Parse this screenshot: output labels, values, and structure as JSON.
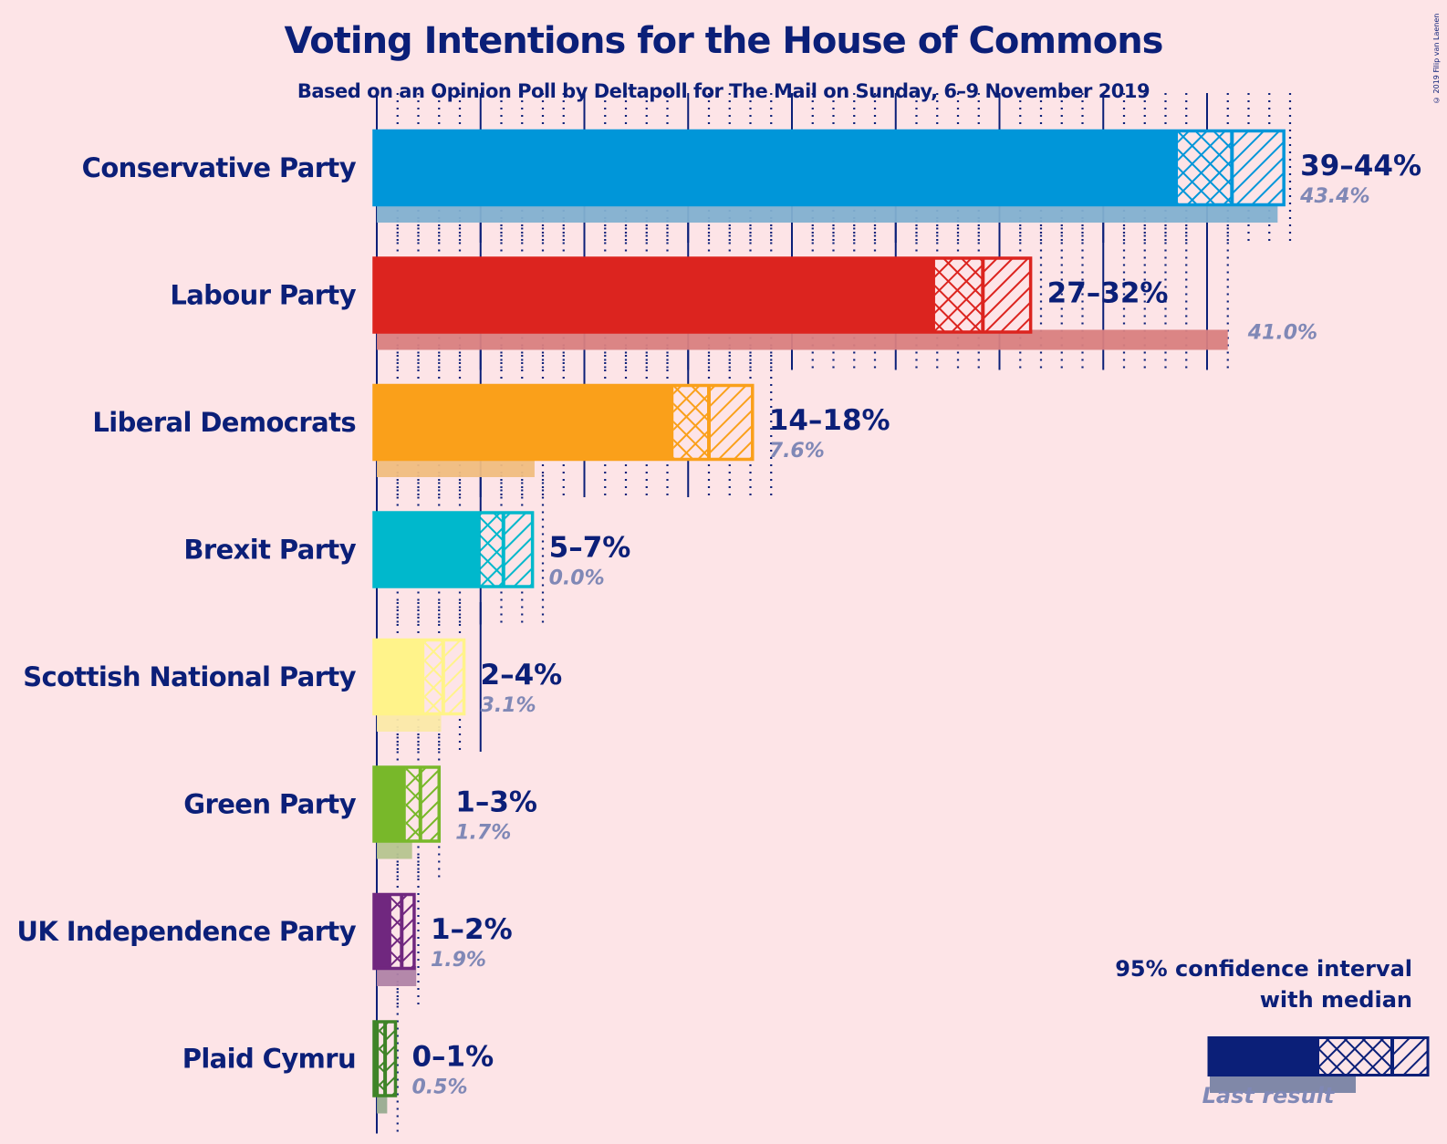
{
  "title": "Voting Intentions for the House of Commons",
  "subtitle": "Based on an Opinion Poll by Deltapoll for The Mail on Sunday, 6–9 November 2019",
  "copyright": "© 2019 Filip van Laenen",
  "legend": {
    "title_line1": "95% confidence interval",
    "title_line2": "with median",
    "last_result": "Last result",
    "color": "#0b1f78"
  },
  "chart_data": {
    "type": "bar",
    "title": "Voting Intentions for the House of Commons",
    "subtitle": "Based on an Opinion Poll by Deltapoll for The Mail on Sunday, 6–9 November 2019",
    "xlabel": "",
    "ylabel": "",
    "unit": "%",
    "xlim": [
      0,
      45
    ],
    "grid": {
      "major_every": 5,
      "minor_every": 1
    },
    "legend_position": "bottom-right",
    "categories": [
      "Conservative Party",
      "Labour Party",
      "Liberal Democrats",
      "Brexit Party",
      "Scottish National Party",
      "Green Party",
      "UK Independence Party",
      "Plaid Cymru"
    ],
    "series": [
      {
        "name": "95% confidence interval low",
        "values": [
          38.6,
          26.9,
          14.3,
          5.0,
          2.3,
          1.4,
          0.7,
          0.1
        ]
      },
      {
        "name": "Median",
        "values": [
          41.2,
          29.2,
          16.0,
          6.1,
          3.2,
          2.1,
          1.2,
          0.4
        ]
      },
      {
        "name": "95% confidence interval high",
        "values": [
          43.7,
          31.5,
          18.1,
          7.5,
          4.2,
          3.0,
          1.8,
          0.9
        ]
      },
      {
        "name": "Last result",
        "values": [
          43.4,
          41.0,
          7.6,
          0.0,
          3.1,
          1.7,
          1.9,
          0.5
        ]
      }
    ],
    "range_labels": [
      "39–44%",
      "27–32%",
      "14–18%",
      "5–7%",
      "2–4%",
      "1–3%",
      "1–2%",
      "0–1%"
    ],
    "last_labels": [
      "43.4%",
      "41.0%",
      "7.6%",
      "0.0%",
      "3.1%",
      "1.7%",
      "1.9%",
      "0.5%"
    ],
    "colors": [
      "#0096d9",
      "#dc241f",
      "#faa01a",
      "#00b8cc",
      "#fff38a",
      "#78b82a",
      "#70277f",
      "#3f8428"
    ],
    "last_colors": [
      "#82b0d0",
      "#d98080",
      "#f0bd80",
      "#80c8d2",
      "#fbe9a8",
      "#b6c48f",
      "#b083a6",
      "#98ab90"
    ]
  }
}
